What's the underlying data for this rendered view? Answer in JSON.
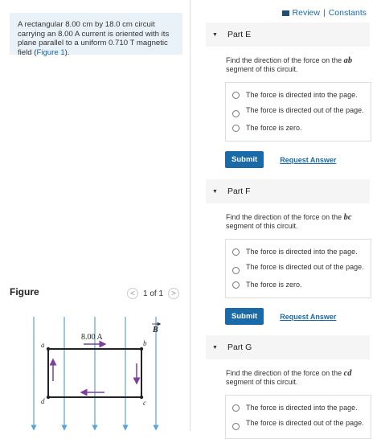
{
  "topbar": {
    "review": "Review",
    "separator": "|",
    "constants": "Constants"
  },
  "problem": {
    "text_before_link": "A rectangular 8.00 cm by 18.0 cm circuit carrying an 8.00 A current is oriented with its plane parallel to a uniform 0.710 T magnetic field (",
    "link": "Figure 1",
    "text_after_link": ")."
  },
  "figure": {
    "title": "Figure",
    "pager": {
      "text": "1 of 1",
      "prev": "<",
      "next": ">"
    },
    "current_label": "8.00 A",
    "field_label": "B",
    "corners": {
      "a": "a",
      "b": "b",
      "c": "c",
      "d": "d"
    }
  },
  "parts": [
    {
      "title": "Part E",
      "question_before": "Find the direction of the force on the ",
      "segment": "ab",
      "question_after": " segment of this circuit.",
      "options": [
        "The force is directed into the page.",
        "The force is directed out of the page.",
        "The force is zero."
      ],
      "submit": "Submit",
      "request": "Request Answer"
    },
    {
      "title": "Part F",
      "question_before": "Find the direction of the force on the ",
      "segment": "bc",
      "question_after": " segment of this circuit.",
      "options": [
        "The force is directed into the page.",
        "The force is directed out of the page.",
        "The force is zero."
      ],
      "submit": "Submit",
      "request": "Request Answer"
    },
    {
      "title": "Part G",
      "question_before": "Find the direction of the force on the ",
      "segment": "cd",
      "question_after": " segment of this circuit.",
      "options": [
        "The force is directed into the page.",
        "The force is directed out of the page."
      ]
    }
  ],
  "colors": {
    "accent": "#1a6aa8",
    "field_lines": "#5ba3d6",
    "arrow_purple": "#7b3f9e"
  }
}
